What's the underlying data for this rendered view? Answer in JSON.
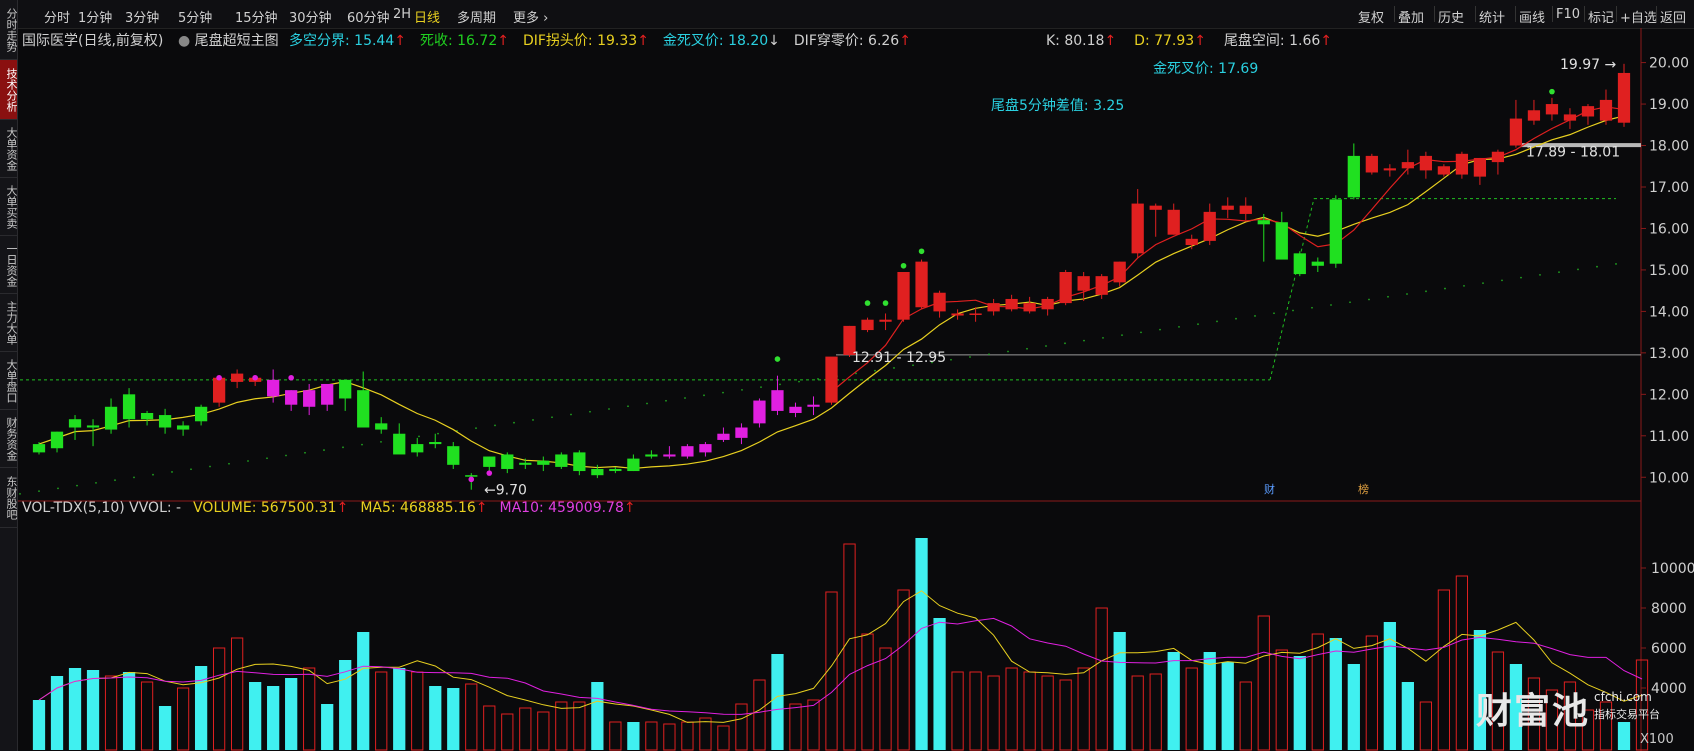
{
  "sidebar": {
    "items": [
      {
        "label": "分时走势"
      },
      {
        "label": "技术分析"
      },
      {
        "label": "大单资金"
      },
      {
        "label": "大单买卖"
      },
      {
        "label": "一日资金"
      },
      {
        "label": "主力大单"
      },
      {
        "label": "大单盘口"
      },
      {
        "label": "财务资金"
      },
      {
        "label": "东财股吧"
      }
    ],
    "active_index": 1
  },
  "toolbar": {
    "periods": [
      "分时",
      "1分钟",
      "3分钟",
      "5分钟",
      "15分钟",
      "30分钟",
      "60分钟",
      "2H",
      "日线",
      "多周期",
      "更多 ›"
    ],
    "active_period": "日线",
    "right_items": [
      "复权",
      "叠加",
      "历史",
      "统计",
      "画线",
      "F10",
      "标记",
      "+自选",
      "返回"
    ]
  },
  "main_indicator": {
    "stock": "国际医学(日线,前复权)",
    "formula": "尾盘超短主图",
    "items": [
      {
        "label": "多空分界: 15.44",
        "arrow": "↑",
        "color": "#2ad0e0"
      },
      {
        "label": "死收: 16.72",
        "arrow": "↑",
        "color": "#20d020"
      },
      {
        "label": "DIF拐头价: 19.33",
        "arrow": "↑",
        "color": "#e8d020"
      },
      {
        "label": "金死叉价: 18.20",
        "arrow": "↓",
        "color": "#2ad0e0"
      },
      {
        "label": "DIF穿零价: 6.26",
        "arrow": "↑",
        "color": "#d0d0d0"
      }
    ],
    "right_items": [
      {
        "label": "K: 80.18",
        "arrow": "↑",
        "color": "#d0d0d0"
      },
      {
        "label": "D: 77.93",
        "arrow": "↑",
        "color": "#e8d020"
      },
      {
        "label": "尾盘空间: 1.66",
        "arrow": "↑",
        "color": "#d0d0d0"
      }
    ],
    "cross_price": "金死叉价: 17.69",
    "tail_diff": "尾盘5分钟差值: 3.25",
    "annotations": {
      "high": "19.97",
      "low": "9.70",
      "zone1": "17.89 - 18.01",
      "zone2": "12.91 - 12.95",
      "flag_cai": "财",
      "flag_bang": "榜"
    }
  },
  "volume_indicator": {
    "items": [
      {
        "label": "VOL-TDX(5,10) VVOL: -",
        "arrow": "",
        "color": "#d0d0d0"
      },
      {
        "label": "VOLUME: 567500.31",
        "arrow": "↑",
        "color": "#e8d020"
      },
      {
        "label": "MA5: 468885.16",
        "arrow": "↑",
        "color": "#e8d020"
      },
      {
        "label": "MA10: 459009.78",
        "arrow": "↑",
        "color": "#e040e0"
      }
    ]
  },
  "watermark": {
    "brand": "财富池",
    "url": "cfchi.com",
    "slogan": "指标交易平台"
  },
  "bottom_label": "X100",
  "colors": {
    "up": "#e02020",
    "down": "#20e020",
    "magenta": "#e020e0",
    "cyan": "#40f0f0",
    "ma_yellow": "#e8d020",
    "ma_red": "#e02020",
    "dotted_green": "#20c020",
    "bg": "#0a0a0c"
  },
  "chart_data": {
    "type": "candlestick",
    "price_axis": {
      "ticks": [
        10.0,
        11.0,
        12.0,
        13.0,
        14.0,
        15.0,
        16.0,
        17.0,
        18.0,
        19.0,
        20.0
      ],
      "ylim": [
        9.5,
        20.4
      ]
    },
    "volume_axis": {
      "ticks": [
        4000,
        6000,
        8000,
        10000
      ],
      "ylim": [
        900,
        12000
      ],
      "unit": "X100"
    },
    "candles": [
      {
        "o": 10.6,
        "h": 10.85,
        "l": 10.55,
        "c": 10.8,
        "color": "down"
      },
      {
        "o": 10.7,
        "h": 11.1,
        "l": 10.6,
        "c": 11.1,
        "color": "down"
      },
      {
        "o": 11.2,
        "h": 11.5,
        "l": 10.9,
        "c": 11.4,
        "color": "down"
      },
      {
        "o": 11.25,
        "h": 11.4,
        "l": 10.75,
        "c": 11.2,
        "color": "down"
      },
      {
        "o": 11.15,
        "h": 11.9,
        "l": 11.05,
        "c": 11.7,
        "color": "down"
      },
      {
        "o": 11.4,
        "h": 12.15,
        "l": 11.2,
        "c": 12.0,
        "color": "down"
      },
      {
        "o": 11.55,
        "h": 11.6,
        "l": 11.25,
        "c": 11.4,
        "color": "down"
      },
      {
        "o": 11.2,
        "h": 11.65,
        "l": 11.05,
        "c": 11.5,
        "color": "down"
      },
      {
        "o": 11.15,
        "h": 11.35,
        "l": 11.0,
        "c": 11.25,
        "color": "down"
      },
      {
        "o": 11.35,
        "h": 11.75,
        "l": 11.25,
        "c": 11.7,
        "color": "down"
      },
      {
        "o": 11.8,
        "h": 12.35,
        "l": 11.7,
        "c": 12.4,
        "color": "up"
      },
      {
        "o": 12.3,
        "h": 12.6,
        "l": 12.15,
        "c": 12.5,
        "color": "up"
      },
      {
        "o": 12.3,
        "h": 12.45,
        "l": 12.2,
        "c": 12.4,
        "color": "up"
      },
      {
        "o": 11.95,
        "h": 12.6,
        "l": 11.8,
        "c": 12.35,
        "color": "magenta"
      },
      {
        "o": 11.75,
        "h": 12.1,
        "l": 11.6,
        "c": 12.1,
        "color": "magenta"
      },
      {
        "o": 11.7,
        "h": 12.25,
        "l": 11.5,
        "c": 12.1,
        "color": "magenta"
      },
      {
        "o": 11.75,
        "h": 12.2,
        "l": 11.6,
        "c": 12.25,
        "color": "magenta"
      },
      {
        "o": 11.9,
        "h": 12.3,
        "l": 11.6,
        "c": 12.35,
        "color": "down"
      },
      {
        "o": 12.1,
        "h": 12.55,
        "l": 11.8,
        "c": 11.2,
        "color": "down"
      },
      {
        "o": 11.3,
        "h": 11.45,
        "l": 11.05,
        "c": 11.15,
        "color": "down"
      },
      {
        "o": 11.05,
        "h": 11.3,
        "l": 10.6,
        "c": 10.55,
        "color": "down"
      },
      {
        "o": 10.8,
        "h": 10.95,
        "l": 10.5,
        "c": 10.6,
        "color": "down"
      },
      {
        "o": 10.85,
        "h": 11.05,
        "l": 10.7,
        "c": 10.8,
        "color": "down"
      },
      {
        "o": 10.75,
        "h": 10.85,
        "l": 10.2,
        "c": 10.3,
        "color": "down"
      },
      {
        "o": 10.05,
        "h": 10.1,
        "l": 9.7,
        "c": 10.02,
        "color": "down"
      },
      {
        "o": 10.25,
        "h": 10.5,
        "l": 10.05,
        "c": 10.5,
        "color": "down"
      },
      {
        "o": 10.55,
        "h": 10.6,
        "l": 10.1,
        "c": 10.2,
        "color": "down"
      },
      {
        "o": 10.35,
        "h": 10.45,
        "l": 10.2,
        "c": 10.3,
        "color": "down"
      },
      {
        "o": 10.3,
        "h": 10.5,
        "l": 10.15,
        "c": 10.4,
        "color": "down"
      },
      {
        "o": 10.55,
        "h": 10.6,
        "l": 10.2,
        "c": 10.25,
        "color": "down"
      },
      {
        "o": 10.6,
        "h": 10.65,
        "l": 10.05,
        "c": 10.15,
        "color": "down"
      },
      {
        "o": 10.2,
        "h": 10.3,
        "l": 9.98,
        "c": 10.05,
        "color": "down"
      },
      {
        "o": 10.15,
        "h": 10.25,
        "l": 10.1,
        "c": 10.2,
        "color": "down"
      },
      {
        "o": 10.45,
        "h": 10.55,
        "l": 10.15,
        "c": 10.15,
        "color": "down"
      },
      {
        "o": 10.55,
        "h": 10.65,
        "l": 10.45,
        "c": 10.5,
        "color": "down"
      },
      {
        "o": 10.55,
        "h": 10.75,
        "l": 10.45,
        "c": 10.5,
        "color": "magenta"
      },
      {
        "o": 10.5,
        "h": 10.8,
        "l": 10.45,
        "c": 10.75,
        "color": "magenta"
      },
      {
        "o": 10.6,
        "h": 10.85,
        "l": 10.5,
        "c": 10.8,
        "color": "magenta"
      },
      {
        "o": 10.9,
        "h": 11.2,
        "l": 10.85,
        "c": 11.05,
        "color": "magenta"
      },
      {
        "o": 10.95,
        "h": 11.3,
        "l": 10.8,
        "c": 11.2,
        "color": "magenta"
      },
      {
        "o": 11.3,
        "h": 11.9,
        "l": 11.2,
        "c": 11.85,
        "color": "magenta"
      },
      {
        "o": 11.6,
        "h": 12.45,
        "l": 11.5,
        "c": 12.1,
        "color": "magenta"
      },
      {
        "o": 11.55,
        "h": 11.8,
        "l": 11.45,
        "c": 11.7,
        "color": "magenta"
      },
      {
        "o": 11.7,
        "h": 11.95,
        "l": 11.5,
        "c": 11.75,
        "color": "magenta"
      },
      {
        "o": 11.8,
        "h": 12.9,
        "l": 11.75,
        "c": 12.91,
        "color": "up"
      },
      {
        "o": 12.95,
        "h": 13.65,
        "l": 12.9,
        "c": 13.65,
        "color": "up"
      },
      {
        "o": 13.55,
        "h": 13.85,
        "l": 13.5,
        "c": 13.8,
        "color": "up"
      },
      {
        "o": 13.75,
        "h": 13.95,
        "l": 13.55,
        "c": 13.8,
        "color": "up"
      },
      {
        "o": 13.8,
        "h": 14.95,
        "l": 13.75,
        "c": 14.95,
        "color": "up"
      },
      {
        "o": 15.2,
        "h": 15.25,
        "l": 14.05,
        "c": 14.1,
        "color": "up"
      },
      {
        "o": 14.0,
        "h": 14.5,
        "l": 13.85,
        "c": 14.45,
        "color": "up"
      },
      {
        "o": 13.95,
        "h": 14.05,
        "l": 13.8,
        "c": 13.9,
        "color": "up"
      },
      {
        "o": 13.95,
        "h": 14.1,
        "l": 13.75,
        "c": 13.95,
        "color": "up"
      },
      {
        "o": 14.0,
        "h": 14.3,
        "l": 13.9,
        "c": 14.2,
        "color": "up"
      },
      {
        "o": 14.3,
        "h": 14.4,
        "l": 14.0,
        "c": 14.05,
        "color": "up"
      },
      {
        "o": 14.0,
        "h": 14.35,
        "l": 13.95,
        "c": 14.2,
        "color": "up"
      },
      {
        "o": 14.05,
        "h": 14.35,
        "l": 13.9,
        "c": 14.3,
        "color": "up"
      },
      {
        "o": 14.2,
        "h": 15.0,
        "l": 14.15,
        "c": 14.95,
        "color": "up"
      },
      {
        "o": 14.5,
        "h": 14.95,
        "l": 14.25,
        "c": 14.85,
        "color": "up"
      },
      {
        "o": 14.4,
        "h": 14.9,
        "l": 14.3,
        "c": 14.85,
        "color": "up"
      },
      {
        "o": 14.7,
        "h": 15.2,
        "l": 14.6,
        "c": 15.2,
        "color": "up"
      },
      {
        "o": 15.4,
        "h": 16.95,
        "l": 15.3,
        "c": 16.6,
        "color": "up"
      },
      {
        "o": 16.45,
        "h": 16.6,
        "l": 15.8,
        "c": 16.55,
        "color": "up"
      },
      {
        "o": 16.45,
        "h": 16.6,
        "l": 15.85,
        "c": 15.85,
        "color": "up"
      },
      {
        "o": 15.6,
        "h": 15.85,
        "l": 15.5,
        "c": 15.75,
        "color": "up"
      },
      {
        "o": 15.7,
        "h": 16.6,
        "l": 15.6,
        "c": 16.4,
        "color": "up"
      },
      {
        "o": 16.45,
        "h": 16.75,
        "l": 16.25,
        "c": 16.55,
        "color": "up"
      },
      {
        "o": 16.55,
        "h": 16.75,
        "l": 16.2,
        "c": 16.35,
        "color": "up"
      },
      {
        "o": 16.2,
        "h": 16.35,
        "l": 15.2,
        "c": 16.1,
        "color": "down"
      },
      {
        "o": 16.15,
        "h": 16.4,
        "l": 15.9,
        "c": 15.25,
        "color": "down"
      },
      {
        "o": 15.4,
        "h": 15.45,
        "l": 14.85,
        "c": 14.9,
        "color": "down"
      },
      {
        "o": 15.1,
        "h": 15.3,
        "l": 14.95,
        "c": 15.2,
        "color": "down"
      },
      {
        "o": 15.15,
        "h": 16.8,
        "l": 15.05,
        "c": 16.7,
        "color": "down"
      },
      {
        "o": 16.75,
        "h": 18.05,
        "l": 16.7,
        "c": 17.75,
        "color": "down"
      },
      {
        "o": 17.35,
        "h": 17.8,
        "l": 17.3,
        "c": 17.75,
        "color": "up"
      },
      {
        "o": 17.4,
        "h": 17.55,
        "l": 17.25,
        "c": 17.45,
        "color": "up"
      },
      {
        "o": 17.45,
        "h": 17.9,
        "l": 17.3,
        "c": 17.6,
        "color": "up"
      },
      {
        "o": 17.4,
        "h": 17.85,
        "l": 17.2,
        "c": 17.75,
        "color": "up"
      },
      {
        "o": 17.3,
        "h": 17.55,
        "l": 17.25,
        "c": 17.5,
        "color": "up"
      },
      {
        "o": 17.3,
        "h": 17.85,
        "l": 17.2,
        "c": 17.8,
        "color": "up"
      },
      {
        "o": 17.25,
        "h": 17.7,
        "l": 17.05,
        "c": 17.7,
        "color": "up"
      },
      {
        "o": 17.6,
        "h": 17.9,
        "l": 17.3,
        "c": 17.85,
        "color": "up"
      },
      {
        "o": 18.0,
        "h": 19.1,
        "l": 17.95,
        "c": 18.65,
        "color": "up"
      },
      {
        "o": 18.6,
        "h": 19.1,
        "l": 18.5,
        "c": 18.85,
        "color": "up"
      },
      {
        "o": 18.75,
        "h": 19.15,
        "l": 18.6,
        "c": 19.0,
        "color": "up"
      },
      {
        "o": 18.6,
        "h": 18.9,
        "l": 18.4,
        "c": 18.75,
        "color": "up"
      },
      {
        "o": 18.7,
        "h": 19.0,
        "l": 18.5,
        "c": 18.95,
        "color": "up"
      },
      {
        "o": 18.6,
        "h": 19.35,
        "l": 18.5,
        "c": 19.1,
        "color": "up"
      },
      {
        "o": 19.75,
        "h": 19.97,
        "l": 18.45,
        "c": 18.55,
        "color": "up"
      }
    ],
    "volume_bars": [
      3400,
      4600,
      5000,
      4900,
      4600,
      4800,
      4300,
      3100,
      4000,
      5100,
      6000,
      6500,
      4300,
      4100,
      4500,
      5000,
      3200,
      5400,
      6800,
      4800,
      5000,
      4800,
      4100,
      4000,
      4200,
      3100,
      2700,
      3000,
      2800,
      3300,
      3300,
      4300,
      2300,
      2300,
      2300,
      2200,
      2300,
      2500,
      2100,
      3200,
      4400,
      5700,
      3200,
      3400,
      8800,
      11200,
      6700,
      6000,
      8900,
      11500,
      7500,
      4800,
      4800,
      4600,
      5000,
      4800,
      4600,
      4400,
      5000,
      8000,
      6800,
      4600,
      4700,
      5800,
      5000,
      5800,
      5300,
      4300,
      7600,
      5900,
      5600,
      6700,
      6500,
      5200,
      6600,
      7300,
      4300,
      3300,
      8900,
      9600,
      6900,
      5800,
      5200,
      4500,
      3900,
      4300,
      2900,
      3300,
      2300,
      5400
    ],
    "volume_colors": [
      "cyan",
      "cyan",
      "cyan",
      "cyan",
      "red",
      "cyan",
      "red",
      "cyan",
      "red",
      "cyan",
      "red",
      "red",
      "cyan",
      "cyan",
      "cyan",
      "red",
      "cyan",
      "cyan",
      "cyan",
      "red",
      "cyan",
      "red",
      "cyan",
      "cyan",
      "red",
      "red",
      "red",
      "red",
      "red",
      "red",
      "red",
      "cyan",
      "red",
      "cyan",
      "red",
      "red",
      "red",
      "red",
      "red",
      "red",
      "red",
      "cyan",
      "red",
      "red",
      "red",
      "red",
      "red",
      "red",
      "red",
      "cyan",
      "cyan",
      "red",
      "red",
      "red",
      "red",
      "red",
      "red",
      "red",
      "red",
      "red",
      "cyan",
      "red",
      "red",
      "cyan",
      "red",
      "cyan",
      "cyan",
      "red",
      "red",
      "red",
      "cyan",
      "red",
      "cyan",
      "cyan",
      "red",
      "cyan",
      "cyan",
      "red",
      "red",
      "red",
      "cyan",
      "red",
      "cyan",
      "red",
      "red",
      "red",
      "red",
      "red",
      "cyan",
      "red"
    ]
  }
}
